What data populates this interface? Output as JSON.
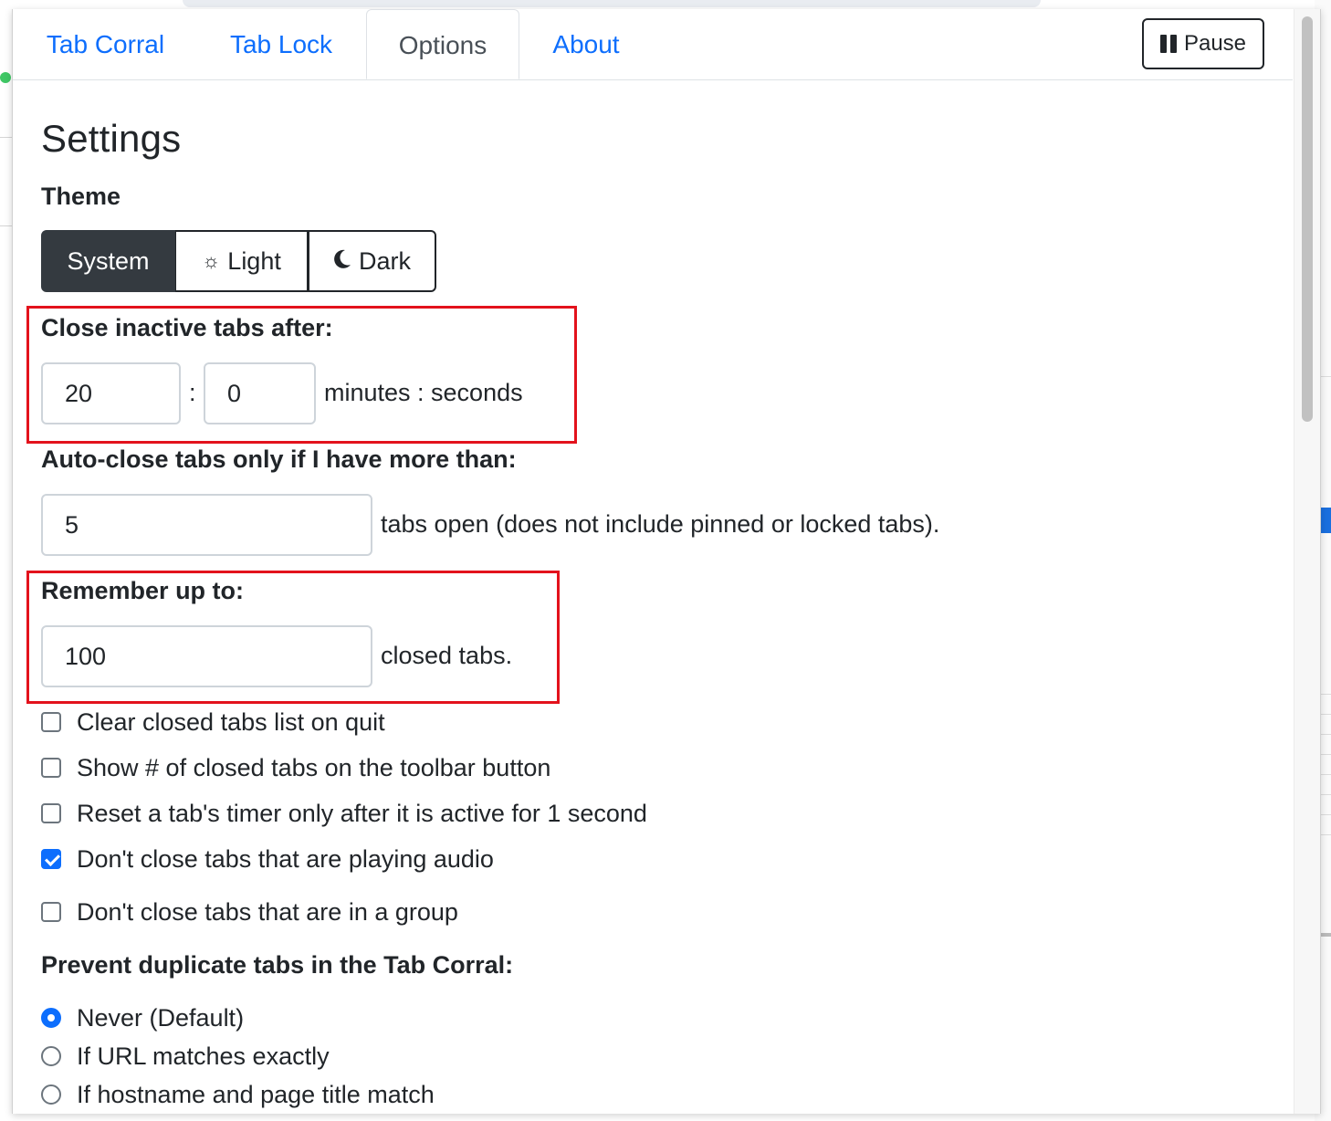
{
  "tabs": {
    "tab_corral": "Tab Corral",
    "tab_lock": "Tab Lock",
    "options": "Options",
    "about": "About",
    "active": "Options"
  },
  "pause_button": {
    "label": "Pause",
    "icon": "pause-icon"
  },
  "settings": {
    "title": "Settings",
    "theme": {
      "label": "Theme",
      "options": [
        "System",
        "Light",
        "Dark"
      ],
      "selected": "System",
      "icons": {
        "Light": "sun-icon",
        "Dark": "moon-icon"
      }
    },
    "close_inactive": {
      "label": "Close inactive tabs after:",
      "minutes": "20",
      "separator": ":",
      "seconds": "0",
      "unit_text": "minutes : seconds"
    },
    "auto_close": {
      "label": "Auto-close tabs only if I have more than:",
      "value": "5",
      "suffix": "tabs open (does not include pinned or locked tabs)."
    },
    "remember": {
      "label": "Remember up to:",
      "value": "100",
      "suffix": "closed tabs."
    },
    "checkboxes": [
      {
        "label": "Clear closed tabs list on quit",
        "checked": false
      },
      {
        "label": "Show # of closed tabs on the toolbar button",
        "checked": false
      },
      {
        "label": "Reset a tab's timer only after it is active for 1 second",
        "checked": false
      },
      {
        "label": "Don't close tabs that are playing audio",
        "checked": true
      },
      {
        "label": "Don't close tabs that are in a group",
        "checked": false
      }
    ],
    "duplicates": {
      "label": "Prevent duplicate tabs in the Tab Corral:",
      "options": [
        {
          "label": "Never (Default)",
          "selected": true
        },
        {
          "label": "If URL matches exactly",
          "selected": false
        },
        {
          "label": "If hostname and page title match",
          "selected": false
        }
      ]
    }
  },
  "colors": {
    "link": "#0d6efd",
    "highlight_box": "#e3121c",
    "selected_button": "#343a40"
  }
}
